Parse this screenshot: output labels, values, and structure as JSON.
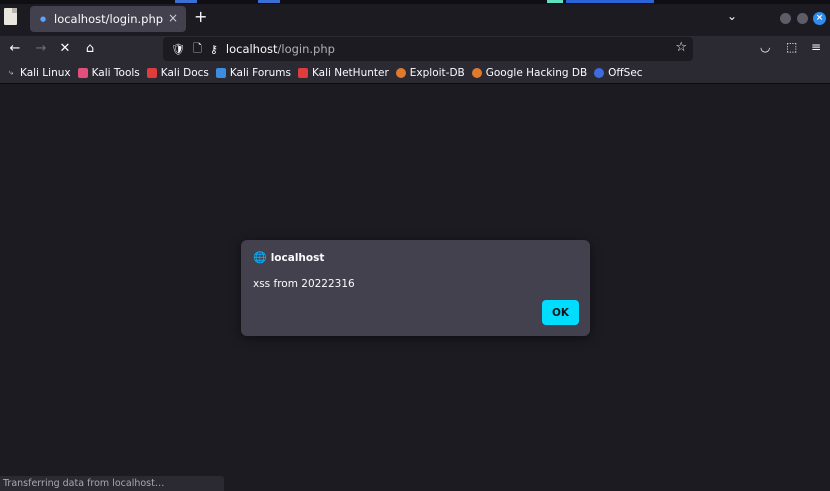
{
  "tab": {
    "title": "localhost/login.php",
    "close": "×"
  },
  "newtab": "+",
  "tabs_menu": "⌄",
  "nav": {
    "back": "←",
    "forward": "→",
    "stop": "✕",
    "home": "⌂"
  },
  "urlbar": {
    "host": "localhost",
    "path": "/login.php"
  },
  "bookmarks": [
    {
      "label": "Kali Linux",
      "icon": "kali-dragon-icon",
      "color": "#d0d0d0"
    },
    {
      "label": "Kali Tools",
      "icon": "kali-tools-icon",
      "color": "#e0507a"
    },
    {
      "label": "Kali Docs",
      "icon": "kali-docs-icon",
      "color": "#e03c3c"
    },
    {
      "label": "Kali Forums",
      "icon": "kali-forums-icon",
      "color": "#3c8ce0"
    },
    {
      "label": "Kali NetHunter",
      "icon": "nethunter-icon",
      "color": "#e03c3c"
    },
    {
      "label": "Exploit-DB",
      "icon": "exploit-db-icon",
      "color": "#e07a2c"
    },
    {
      "label": "Google Hacking DB",
      "icon": "ghdb-icon",
      "color": "#e07a2c"
    },
    {
      "label": "OffSec",
      "icon": "offsec-icon",
      "color": "#3c6ce0"
    }
  ],
  "dialog": {
    "origin": "localhost",
    "message": "xss from 20222316",
    "ok_label": "OK"
  },
  "status": "Transferring data from localhost…",
  "colors": {
    "accent": "#00ddff",
    "chrome": "#2b2a33",
    "background": "#1c1b22",
    "dialog": "#42414d"
  }
}
